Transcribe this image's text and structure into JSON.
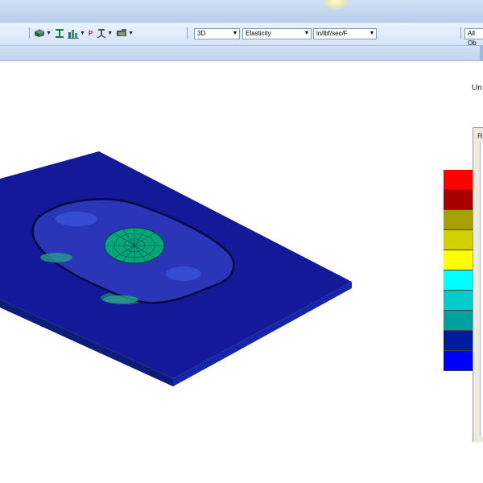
{
  "toolbar": {
    "icons": [
      "cube-view-icon",
      "i-beam-icon",
      "bar-chart-icon",
      "property-icon",
      "stand-icon",
      "cluster-icon"
    ],
    "property_label": "P",
    "combos": {
      "view_mode": "3D",
      "result_type": "Elasticity",
      "units": "in/lbf/sec/F",
      "filter": "All Ob"
    }
  },
  "viewport": {
    "units_text": "Un"
  },
  "legend": {
    "colors": [
      "#ff0000",
      "#a80000",
      "#a8a000",
      "#d4d000",
      "#ffff00",
      "#00ffff",
      "#00cccc",
      "#00a0a0",
      "#001aa0",
      "#0000ff"
    ]
  },
  "panel": {
    "title": "R"
  },
  "colors": {
    "plate_top": "#14199a",
    "plate_side": "#0b1d78",
    "accent": "#00a87a"
  }
}
